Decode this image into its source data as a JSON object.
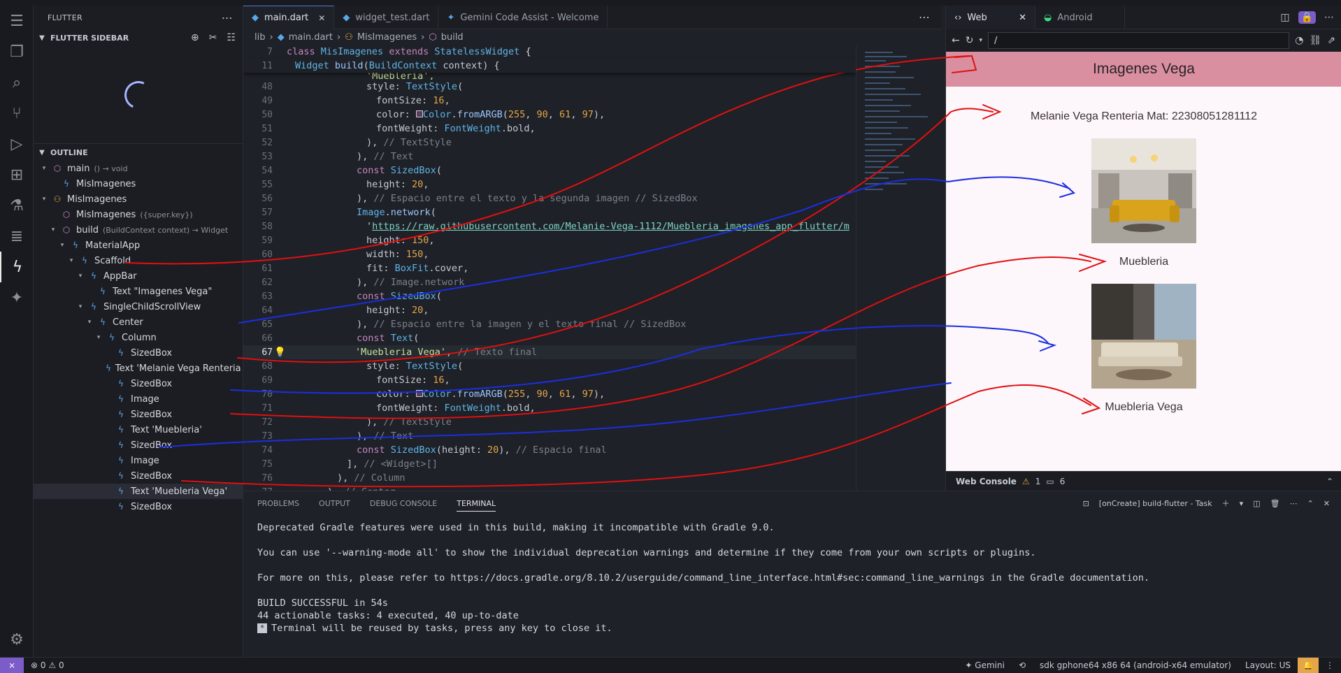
{
  "sidebar": {
    "view_title": "FLUTTER",
    "section_title": "FLUTTER SIDEBAR",
    "outline_title": "OUTLINE",
    "outline": [
      {
        "indent": 0,
        "twist": "▾",
        "icon": "cube",
        "label": "main",
        "detail": "() → void"
      },
      {
        "indent": 1,
        "twist": "",
        "icon": "flutter",
        "label": "MisImagenes",
        "detail": ""
      },
      {
        "indent": 0,
        "twist": "▾",
        "icon": "class",
        "label": "MisImagenes",
        "detail": ""
      },
      {
        "indent": 1,
        "twist": "",
        "icon": "cube",
        "label": "MisImagenes",
        "detail": "({super.key})"
      },
      {
        "indent": 1,
        "twist": "▾",
        "icon": "cube",
        "label": "build",
        "detail": "(BuildContext context) → Widget"
      },
      {
        "indent": 2,
        "twist": "▾",
        "icon": "flutter",
        "label": "MaterialApp",
        "detail": ""
      },
      {
        "indent": 3,
        "twist": "▾",
        "icon": "flutter",
        "label": "Scaffold",
        "detail": ""
      },
      {
        "indent": 4,
        "twist": "▾",
        "icon": "flutter",
        "label": "AppBar",
        "detail": ""
      },
      {
        "indent": 5,
        "twist": "",
        "icon": "flutter",
        "label": "Text \"Imagenes Vega\"",
        "detail": ""
      },
      {
        "indent": 4,
        "twist": "▾",
        "icon": "flutter",
        "label": "SingleChildScrollView",
        "detail": ""
      },
      {
        "indent": 5,
        "twist": "▾",
        "icon": "flutter",
        "label": "Center",
        "detail": ""
      },
      {
        "indent": 6,
        "twist": "▾",
        "icon": "flutter",
        "label": "Column",
        "detail": ""
      },
      {
        "indent": 7,
        "twist": "",
        "icon": "flutter",
        "label": "SizedBox",
        "detail": ""
      },
      {
        "indent": 7,
        "twist": "",
        "icon": "flutter",
        "label": "Text 'Melanie Vega Renteria Ma...",
        "detail": ""
      },
      {
        "indent": 7,
        "twist": "",
        "icon": "flutter",
        "label": "SizedBox",
        "detail": ""
      },
      {
        "indent": 7,
        "twist": "",
        "icon": "flutter",
        "label": "Image",
        "detail": ""
      },
      {
        "indent": 7,
        "twist": "",
        "icon": "flutter",
        "label": "SizedBox",
        "detail": ""
      },
      {
        "indent": 7,
        "twist": "",
        "icon": "flutter",
        "label": "Text 'Muebleria'",
        "detail": ""
      },
      {
        "indent": 7,
        "twist": "",
        "icon": "flutter",
        "label": "SizedBox",
        "detail": ""
      },
      {
        "indent": 7,
        "twist": "",
        "icon": "flutter",
        "label": "Image",
        "detail": ""
      },
      {
        "indent": 7,
        "twist": "",
        "icon": "flutter",
        "label": "SizedBox",
        "detail": ""
      },
      {
        "indent": 7,
        "twist": "",
        "icon": "flutter",
        "label": "Text 'Muebleria Vega'",
        "detail": "",
        "selected": true
      },
      {
        "indent": 7,
        "twist": "",
        "icon": "flutter",
        "label": "SizedBox",
        "detail": ""
      }
    ]
  },
  "editor": {
    "tabs": [
      {
        "label": "main.dart",
        "active": true,
        "close": "✕"
      },
      {
        "label": "widget_test.dart",
        "active": false
      },
      {
        "label": "Gemini Code Assist - Welcome",
        "active": false
      }
    ],
    "breadcrumbs": [
      "lib",
      "main.dart",
      "MisImagenes",
      "build"
    ],
    "current_line": "67"
  },
  "preview": {
    "tabs": [
      "Web",
      "Android"
    ],
    "url": "/",
    "app_title": "Imagenes Vega",
    "student_text": "Melanie Vega Renteria Mat: 22308051281112",
    "caption_1": "Muebleria",
    "caption_2": "Muebleria Vega",
    "console_label": "Web Console",
    "console_warnings": "1",
    "console_messages": "6"
  },
  "panel": {
    "tabs": [
      "PROBLEMS",
      "OUTPUT",
      "DEBUG CONSOLE",
      "TERMINAL"
    ],
    "task": "[onCreate] build-flutter - Task",
    "lines": [
      "Deprecated Gradle features were used in this build, making it incompatible with Gradle 9.0.",
      "",
      "You can use '--warning-mode all' to show the individual deprecation warnings and determine if they come from your own scripts or plugins.",
      "",
      "For more on this, please refer to https://docs.gradle.org/8.10.2/userguide/command_line_interface.html#sec:command_line_warnings in the Gradle documentation.",
      "",
      "BUILD SUCCESSFUL in 54s",
      "44 actionable tasks: 4 executed, 40 up-to-date"
    ],
    "last_line": "Terminal will be reused by tasks, press any key to close it."
  },
  "status": {
    "errors": "0",
    "warnings": "0",
    "gemini": "Gemini",
    "device": "sdk gphone64 x86 64 (android-x64 emulator)",
    "layout": "Layout: US"
  },
  "colors": {
    "accent": "#7b5cc9",
    "appbar": "#d98fa0",
    "ink_red": "#e01010",
    "ink_blue": "#1a2fe0"
  }
}
